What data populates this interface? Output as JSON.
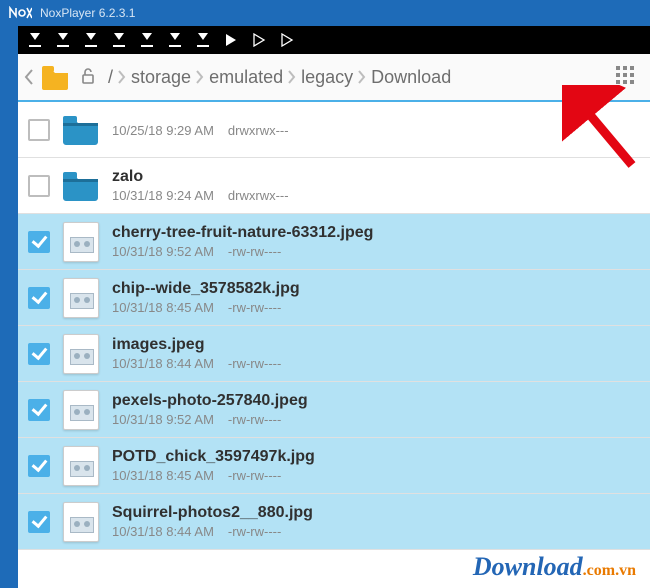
{
  "app": {
    "title": "NoxPlayer 6.2.3.1"
  },
  "breadcrumb": {
    "root": "/",
    "items": [
      "storage",
      "emulated",
      "legacy",
      "Download"
    ]
  },
  "files": [
    {
      "name": "",
      "date": "10/25/18 9:29 AM",
      "perm": "drwxrwx---",
      "type": "folder",
      "selected": false
    },
    {
      "name": "zalo",
      "date": "10/31/18 9:24 AM",
      "perm": "drwxrwx---",
      "type": "folder",
      "selected": false
    },
    {
      "name": "cherry-tree-fruit-nature-63312.jpeg",
      "date": "10/31/18 9:52 AM",
      "perm": "-rw-rw----",
      "type": "image",
      "selected": true
    },
    {
      "name": "chip--wide_3578582k.jpg",
      "date": "10/31/18 8:45 AM",
      "perm": "-rw-rw----",
      "type": "image",
      "selected": true
    },
    {
      "name": "images.jpeg",
      "date": "10/31/18 8:44 AM",
      "perm": "-rw-rw----",
      "type": "image",
      "selected": true
    },
    {
      "name": "pexels-photo-257840.jpeg",
      "date": "10/31/18 9:52 AM",
      "perm": "-rw-rw----",
      "type": "image",
      "selected": true
    },
    {
      "name": "POTD_chick_3597497k.jpg",
      "date": "10/31/18 8:45 AM",
      "perm": "-rw-rw----",
      "type": "image",
      "selected": true
    },
    {
      "name": "Squirrel-photos2__880.jpg",
      "date": "10/31/18 8:44 AM",
      "perm": "-rw-rw----",
      "type": "image",
      "selected": true
    }
  ],
  "watermark": {
    "brand": "Download",
    "suffix": ".com.vn"
  }
}
